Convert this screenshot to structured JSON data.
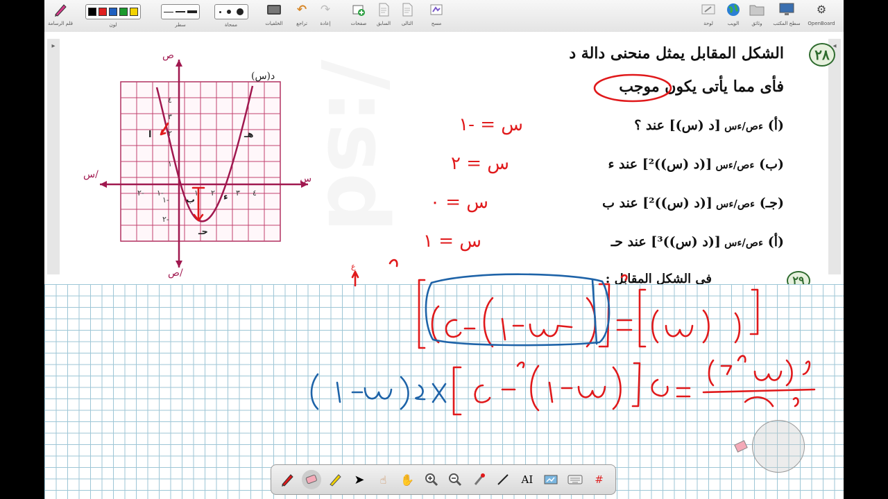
{
  "toolbar": {
    "left": [
      {
        "id": "pen",
        "label": "قلم الرسامة",
        "icon": "pen-icon"
      },
      {
        "id": "color",
        "label": "لون",
        "colors": [
          "#000000",
          "#e02020",
          "#1f5fbf",
          "#1c9a2e",
          "#f3d300"
        ]
      },
      {
        "id": "line",
        "label": "سطر"
      },
      {
        "id": "eraser",
        "label": "ممحاة"
      },
      {
        "id": "bg",
        "label": "الخلفيات",
        "icon": "background-icon"
      },
      {
        "id": "undo",
        "label": "تراجع",
        "icon": "undo-icon"
      },
      {
        "id": "redo",
        "label": "إعادة",
        "icon": "redo-icon"
      },
      {
        "id": "pages",
        "label": "صفحات",
        "icon": "add-page-icon"
      },
      {
        "id": "prev",
        "label": "السابق",
        "icon": "previous-page-icon"
      },
      {
        "id": "next",
        "label": "التالى",
        "icon": "next-page-icon"
      },
      {
        "id": "clear",
        "label": "مسح",
        "icon": "clear-page-icon"
      }
    ],
    "right": [
      {
        "id": "board",
        "label": "لوحة",
        "icon": "board-icon"
      },
      {
        "id": "web",
        "label": "الويب",
        "icon": "web-globe-icon"
      },
      {
        "id": "docs",
        "label": "وثائق",
        "icon": "documents-folder-icon"
      },
      {
        "id": "desktop",
        "label": "سطح المكتب",
        "icon": "desktop-icon"
      },
      {
        "id": "openboard",
        "label": "OpenBoard",
        "icon": "openboard-gear-icon"
      }
    ]
  },
  "question": {
    "number": "٢٨",
    "line1": "الشكل المقابل يمثل منحنى دالة د",
    "line2": "فأى مما يأتى يكون موجب",
    "options": [
      {
        "label": "(أ)",
        "text": "[د (س)] عند ؟"
      },
      {
        "label": "(ب)",
        "text": "[(د (س))²] عند ء"
      },
      {
        "label": "(جـ)",
        "text": "[(د (س))²] عند ب"
      },
      {
        "label": "(أ)",
        "text": "[(د (س))³] عند حـ"
      }
    ],
    "next_number": "٢٩",
    "next_text": "فى الشكل المقابل :"
  },
  "graph": {
    "y_label": "ص",
    "y_neg_label": "ص/",
    "x_label": "س",
    "x_neg_label": "س/",
    "curve_label": "د(س)",
    "x_ticks": [
      "٢-",
      "١-",
      "١",
      "٢",
      "٣",
      "٤"
    ],
    "y_ticks": [
      "٤",
      "٣",
      "٢",
      "١",
      "١-",
      "٢-"
    ],
    "points": [
      "ا",
      "هـ",
      "ب",
      "ء",
      "حـ"
    ]
  },
  "handwriting": {
    "opt_a": "س = -١",
    "opt_b": "س = ٢",
    "opt_c": "س = ٠",
    "opt_d": "س = ١"
  },
  "bottom_tools": [
    "pen-tool-icon",
    "eraser-tool-icon",
    "marker-tool-icon",
    "selector-arrow-icon",
    "interact-hand-icon",
    "pan-hand-icon",
    "zoom-in-icon",
    "zoom-out-icon",
    "laser-pointer-icon",
    "line-tool-icon",
    "text-tool-icon",
    "capture-icon",
    "virtual-keyboard-icon",
    "magnet-grid-icon"
  ]
}
